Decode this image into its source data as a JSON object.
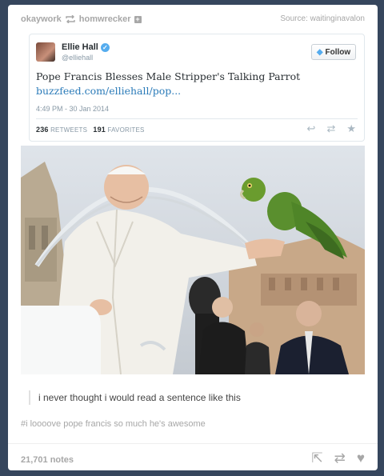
{
  "header": {
    "reblogger": "okaywork",
    "source_blog": "homwrecker",
    "source_label": "Source: waitinginavalon"
  },
  "tweet": {
    "name": "Ellie Hall",
    "handle": "@elliehall",
    "follow_label": "Follow",
    "text": "Pope Francis Blesses Male Stripper's Talking Parrot",
    "link": "buzzfeed.com/elliehall/pop...",
    "timestamp": "4:49 PM - 30 Jan 2014",
    "retweets": "236",
    "retweets_label": "RETWEETS",
    "favorites": "191",
    "favorites_label": "FAVORITES"
  },
  "photo": {
    "icons": [
      "parrot",
      "pope"
    ]
  },
  "caption": "i never thought i would read a sentence like this",
  "tags": "#i loooove pope francis so much he's awesome",
  "footer": {
    "notes": "21,701 notes"
  },
  "colors": {
    "dashboard_bg": "#36465d",
    "twitter_blue": "#55acee",
    "link_blue": "#2b7bb9"
  }
}
